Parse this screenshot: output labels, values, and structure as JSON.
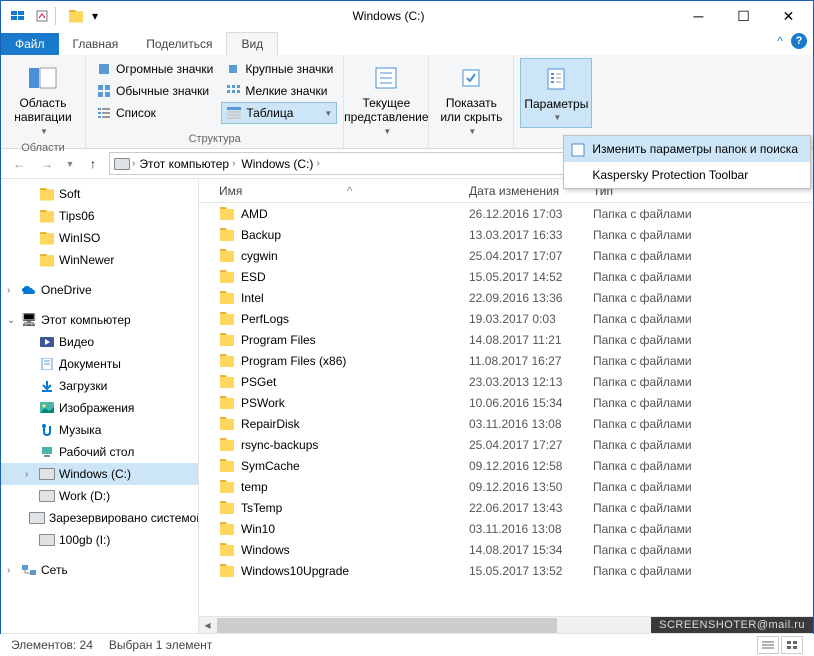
{
  "window": {
    "title": "Windows (C:)"
  },
  "tabs": {
    "file": "Файл",
    "home": "Главная",
    "share": "Поделиться",
    "view": "Вид"
  },
  "ribbon": {
    "pane": {
      "btn": "Область навигации",
      "group": "Области"
    },
    "layout": {
      "huge": "Огромные значки",
      "large": "Крупные значки",
      "normal": "Обычные значки",
      "small": "Мелкие значки",
      "list": "Список",
      "table": "Таблица",
      "group": "Структура"
    },
    "view": {
      "current": "Текущее представление",
      "showHide": "Показать или скрыть",
      "options": "Параметры"
    },
    "popup": {
      "changeOptions": "Изменить параметры папок и поиска",
      "kaspersky": "Kaspersky Protection Toolbar"
    }
  },
  "breadcrumb": {
    "pc": "Этот компьютер",
    "drive": "Windows (C:)"
  },
  "tree": {
    "quick": [
      {
        "name": "Soft"
      },
      {
        "name": "Tips06"
      },
      {
        "name": "WinISO"
      },
      {
        "name": "WinNewer"
      }
    ],
    "onedrive": "OneDrive",
    "thispc": "Этот компьютер",
    "pcKids": [
      {
        "name": "Видео"
      },
      {
        "name": "Документы"
      },
      {
        "name": "Загрузки"
      },
      {
        "name": "Изображения"
      },
      {
        "name": "Музыка"
      },
      {
        "name": "Рабочий стол"
      },
      {
        "name": "Windows (C:)",
        "sel": true,
        "drive": true
      },
      {
        "name": "Work (D:)",
        "drive": true
      },
      {
        "name": "Зарезервировано системой (G:)",
        "drive": true
      },
      {
        "name": "100gb (I:)",
        "drive": true
      }
    ],
    "network": "Сеть"
  },
  "columns": {
    "name": "Имя",
    "date": "Дата изменения",
    "type": "Тип"
  },
  "typeFolder": "Папка с файлами",
  "rows": [
    {
      "name": "AMD",
      "date": "26.12.2016 17:03"
    },
    {
      "name": "Backup",
      "date": "13.03.2017 16:33"
    },
    {
      "name": "cygwin",
      "date": "25.04.2017 17:07"
    },
    {
      "name": "ESD",
      "date": "15.05.2017 14:52"
    },
    {
      "name": "Intel",
      "date": "22.09.2016 13:36"
    },
    {
      "name": "PerfLogs",
      "date": "19.03.2017 0:03"
    },
    {
      "name": "Program Files",
      "date": "14.08.2017 11:21"
    },
    {
      "name": "Program Files (x86)",
      "date": "11.08.2017 16:27"
    },
    {
      "name": "PSGet",
      "date": "23.03.2013 12:13"
    },
    {
      "name": "PSWork",
      "date": "10.06.2016 15:34"
    },
    {
      "name": "RepairDisk",
      "date": "03.11.2016 13:08"
    },
    {
      "name": "rsync-backups",
      "date": "25.04.2017 17:27"
    },
    {
      "name": "SymCache",
      "date": "09.12.2016 12:58"
    },
    {
      "name": "temp",
      "date": "09.12.2016 13:50"
    },
    {
      "name": "TsTemp",
      "date": "22.06.2017 13:43"
    },
    {
      "name": "Win10",
      "date": "03.11.2016 13:08"
    },
    {
      "name": "Windows",
      "date": "14.08.2017 15:34"
    },
    {
      "name": "Windows10Upgrade",
      "date": "15.05.2017 13:52"
    }
  ],
  "status": {
    "items": "Элементов: 24",
    "selected": "Выбран 1 элемент"
  },
  "watermark": "SCREENSHOTER@mail.ru"
}
